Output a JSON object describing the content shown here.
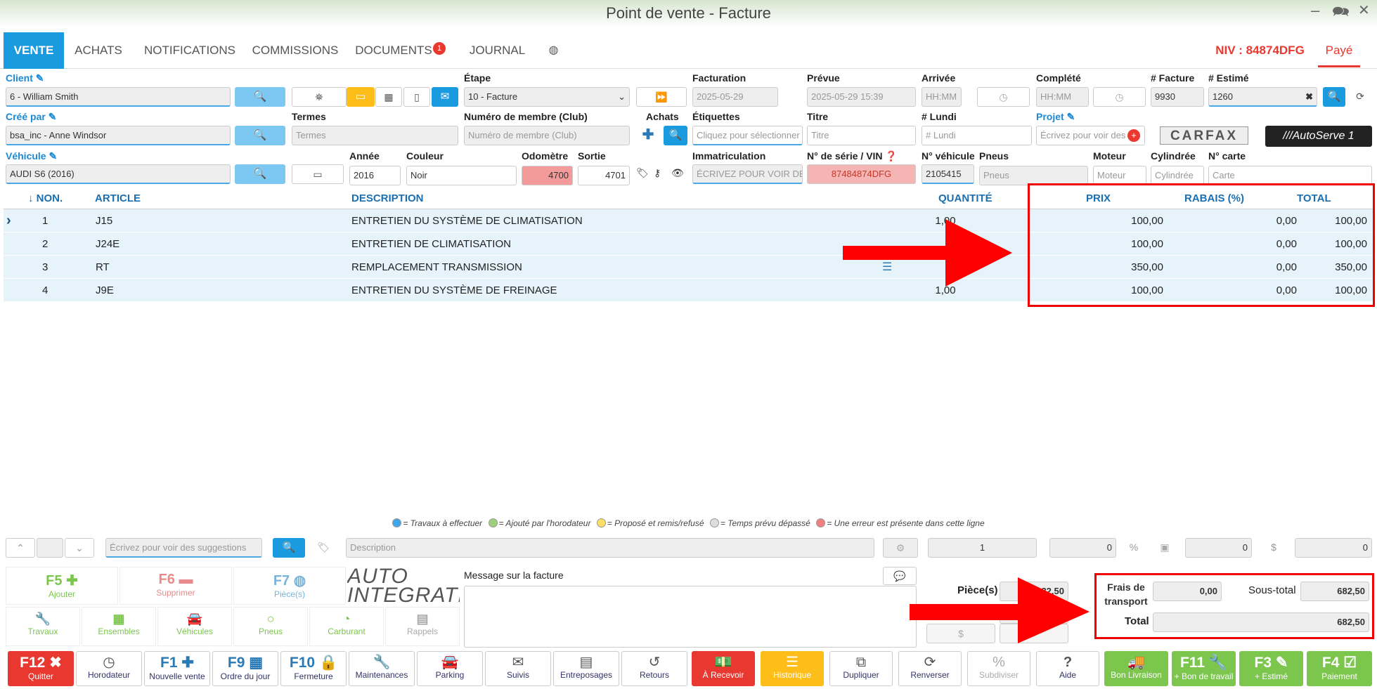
{
  "window": {
    "title": "Point de vente - Facture",
    "minimize": "–",
    "chat": "🗪",
    "close": "✕"
  },
  "tabs": [
    {
      "label": "VENTE"
    },
    {
      "label": "ACHATS"
    },
    {
      "label": "NOTIFICATIONS"
    },
    {
      "label": "COMMISSIONS"
    },
    {
      "label": "DOCUMENTS",
      "badge": "1"
    },
    {
      "label": "JOURNAL"
    }
  ],
  "header_right": {
    "niv": "NIV : 84874DFG",
    "status": "Payé"
  },
  "form": {
    "client_label": "Client",
    "client_value": "6 - William Smith",
    "etape_label": "Étape",
    "etape_value": "10 - Facture",
    "facturation_label": "Facturation",
    "facturation_value": "2025-05-29",
    "prevue_label": "Prévue",
    "prevue_value": "2025-05-29 15:39",
    "arrivee_label": "Arrivée",
    "arrivee_ph": "HH:MM",
    "complete_label": "Complété",
    "complete_ph": "HH:MM",
    "facture_label": "# Facture",
    "facture_value": "9930",
    "estime_label": "# Estimé",
    "estime_value": "1260",
    "cree_label": "Créé par",
    "cree_value": "bsa_inc - Anne Windsor",
    "termes_label": "Termes",
    "termes_ph": "Termes",
    "membre_label": "Numéro de membre (Club)",
    "membre_ph": "Numéro de membre (Club)",
    "achats_label": "Achats",
    "etiquettes_label": "Étiquettes",
    "etiquettes_ph": "Cliquez pour sélectionner",
    "titre_label": "Titre",
    "titre_ph": "Titre",
    "lundi_label": "# Lundi",
    "lundi_ph": "# Lundi",
    "projet_label": "Projet",
    "projet_ph": "Écrivez pour voir des",
    "carfax": "CARFAX",
    "autoserve": "///AutoServe 1",
    "vehicule_label": "Véhicule",
    "vehicule_value": "AUDI S6 (2016)",
    "annee_label": "Année",
    "annee_value": "2016",
    "couleur_label": "Couleur",
    "couleur_value": "Noir",
    "odometre_label": "Odomètre",
    "odometre_value": "4700",
    "sortie_label": "Sortie",
    "sortie_value": "4701",
    "immat_label": "Immatriculation",
    "immat_ph": "ÉCRIVEZ POUR VOIR DES",
    "vin_label": "N° de série / VIN",
    "vin_value": "87484874DFG",
    "noveh_label": "N° véhicule",
    "noveh_value": "2105415",
    "pneus_label": "Pneus",
    "pneus_ph": "Pneus",
    "moteur_label": "Moteur",
    "moteur_ph": "Moteur",
    "cyl_label": "Cylindrée",
    "cyl_ph": "Cylindrée",
    "carte_label": "N° carte",
    "carte_ph": "Carte"
  },
  "table": {
    "headers": {
      "no": "↓ NON.",
      "article": "ARTICLE",
      "description": "DESCRIPTION",
      "quantite": "QUANTITÉ",
      "prix": "PRIX",
      "rabais": "RABAIS (%)",
      "total": "TOTAL"
    },
    "rows": [
      {
        "no": "1",
        "article": "J15",
        "description": "ENTRETIEN DU SYSTÈME DE CLIMATISATION",
        "quantite": "1,00",
        "prix": "100,00",
        "rabais": "0,00",
        "total": "100,00"
      },
      {
        "no": "2",
        "article": "J24E",
        "description": "ENTRETIEN DE CLIMATISATION",
        "quantite": "",
        "prix": "100,00",
        "rabais": "0,00",
        "total": "100,00"
      },
      {
        "no": "3",
        "article": "RT",
        "description": "REMPLACEMENT TRANSMISSION",
        "quantite": "",
        "prix": "350,00",
        "rabais": "0,00",
        "total": "350,00"
      },
      {
        "no": "4",
        "article": "J9E",
        "description": "ENTRETIEN DU SYSTÈME DE FREINAGE",
        "quantite": "1,00",
        "prix": "100,00",
        "rabais": "0,00",
        "total": "100,00"
      }
    ]
  },
  "legend": {
    "a": "= Travaux à effectuer",
    "b": "= Ajouté par l'horodateur",
    "c": "= Proposé et remis/refusé",
    "d": "= Temps prévu dépassé",
    "e": "= Une erreur est présente dans cette ligne",
    "colors": {
      "a": "#3fa6ea",
      "b": "#9ed07b",
      "c": "#ffe066",
      "d": "#dddddd",
      "e": "#f08080"
    }
  },
  "line_edit": {
    "suggest_ph": "Écrivez pour voir des suggestions",
    "desc_ph": "Description",
    "qty": "1",
    "v1": "0",
    "v2": "0",
    "v3": "0"
  },
  "actions": {
    "f5": "F5",
    "f5_lbl": "Ajouter",
    "f6": "F6",
    "f6_lbl": "Supprimer",
    "f7": "F7",
    "f7_lbl": "Pièce(s)",
    "travaux": "Travaux",
    "ensembles": "Ensembles",
    "vehicules": "Véhicules",
    "pneus": "Pneus",
    "carburant": "Carburant",
    "rappels": "Rappels",
    "logo": "AUTO INTEGRATE"
  },
  "message": {
    "label": "Message sur la facture"
  },
  "totals": {
    "pieces_label": "Pièce(s)",
    "pieces_value": "32,50",
    "frais_label": "Frais de transport",
    "frais_value": "0,00",
    "soustotal_label": "Sous-total",
    "soustotal_value": "682,50",
    "total_label": "Total",
    "total_value": "682,50"
  },
  "footer": [
    {
      "key": "F12",
      "icon": "✖",
      "label": "Quitter",
      "style": "red"
    },
    {
      "key": "",
      "icon": "◷",
      "label": "Horodateur"
    },
    {
      "key": "F1",
      "icon": "✚",
      "label": "Nouvelle vente"
    },
    {
      "key": "F9",
      "icon": "▦",
      "label": "Ordre du jour"
    },
    {
      "key": "F10",
      "icon": "🔒",
      "label": "Fermeture"
    },
    {
      "key": "",
      "icon": "🔧",
      "label": "Maintenances"
    },
    {
      "key": "",
      "icon": "🚘",
      "label": "Parking"
    },
    {
      "key": "",
      "icon": "✉",
      "label": "Suivis"
    },
    {
      "key": "",
      "icon": "▤",
      "label": "Entreposages"
    },
    {
      "key": "",
      "icon": "↺",
      "label": "Retours"
    },
    {
      "key": "",
      "icon": "💵",
      "label": "À Recevoir",
      "style": "red"
    },
    {
      "key": "",
      "icon": "☰",
      "label": "Historique",
      "style": "orange"
    },
    {
      "key": "",
      "icon": "⧉",
      "label": "Dupliquer"
    },
    {
      "key": "",
      "icon": "⟳",
      "label": "Renverser"
    },
    {
      "key": "",
      "icon": "%",
      "label": "Subdiviser"
    },
    {
      "key": "",
      "icon": "?",
      "label": "Aide"
    },
    {
      "key": "",
      "icon": "🚚",
      "label": "Bon Livraison",
      "style": "green"
    },
    {
      "key": "F11",
      "icon": "🔧",
      "label": "+ Bon de travail",
      "style": "green"
    },
    {
      "key": "F3",
      "icon": "✎",
      "label": "+ Estimé",
      "style": "green"
    },
    {
      "key": "F4",
      "icon": "☑",
      "label": "Paiement",
      "style": "green"
    }
  ]
}
